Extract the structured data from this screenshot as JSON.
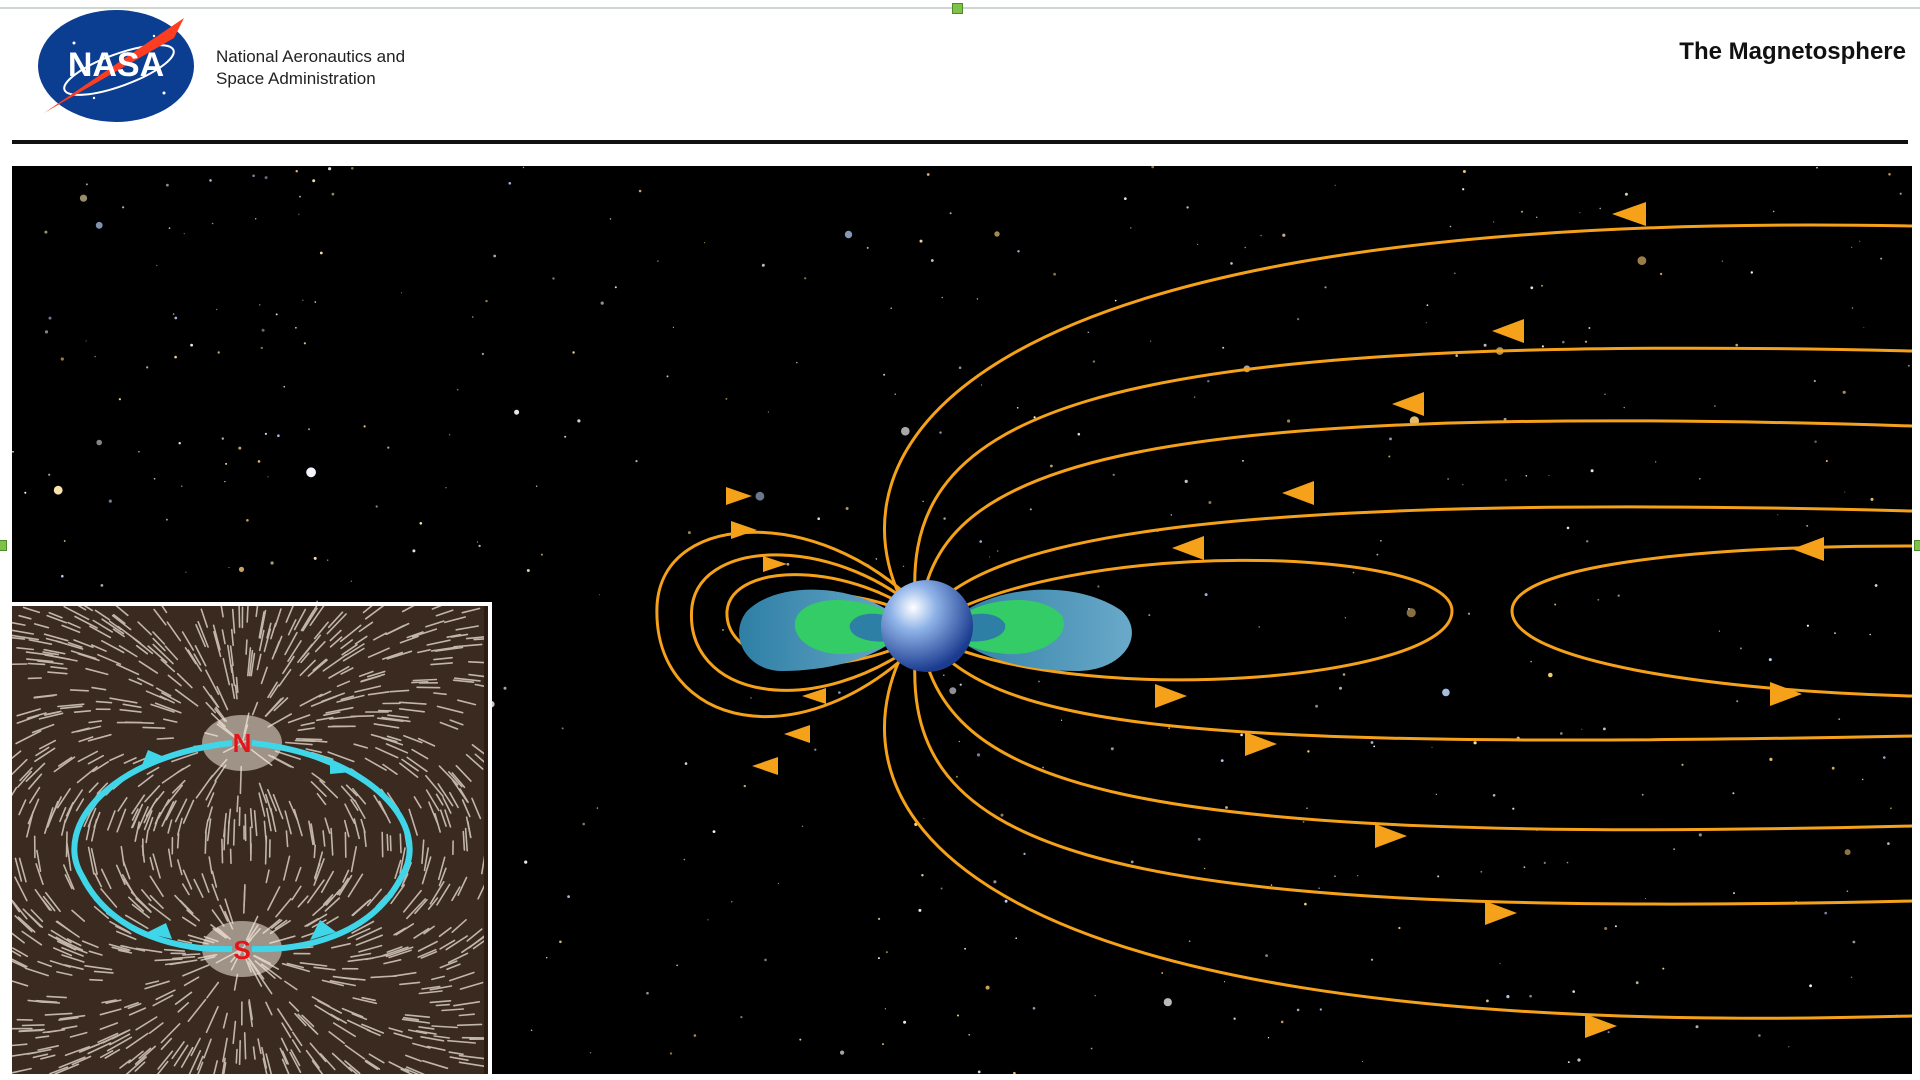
{
  "header": {
    "logo_text": "NASA",
    "agency_line1": "National Aeronautics and",
    "agency_line2": "Space Administration",
    "title": "The Magnetosphere"
  },
  "inset": {
    "north_label": "N",
    "south_label": "S"
  },
  "icons": {
    "logo": "nasa-meatball-logo",
    "planet": "earth-sphere-icon"
  },
  "colors": {
    "field_lines": "#f5a21a",
    "radiation_belt_outer": "#3a8fb0",
    "radiation_belt_inner": "#33cc66",
    "inset_loop": "#3fd6ea",
    "pole_label": "#e5141b",
    "space": "#000000"
  }
}
